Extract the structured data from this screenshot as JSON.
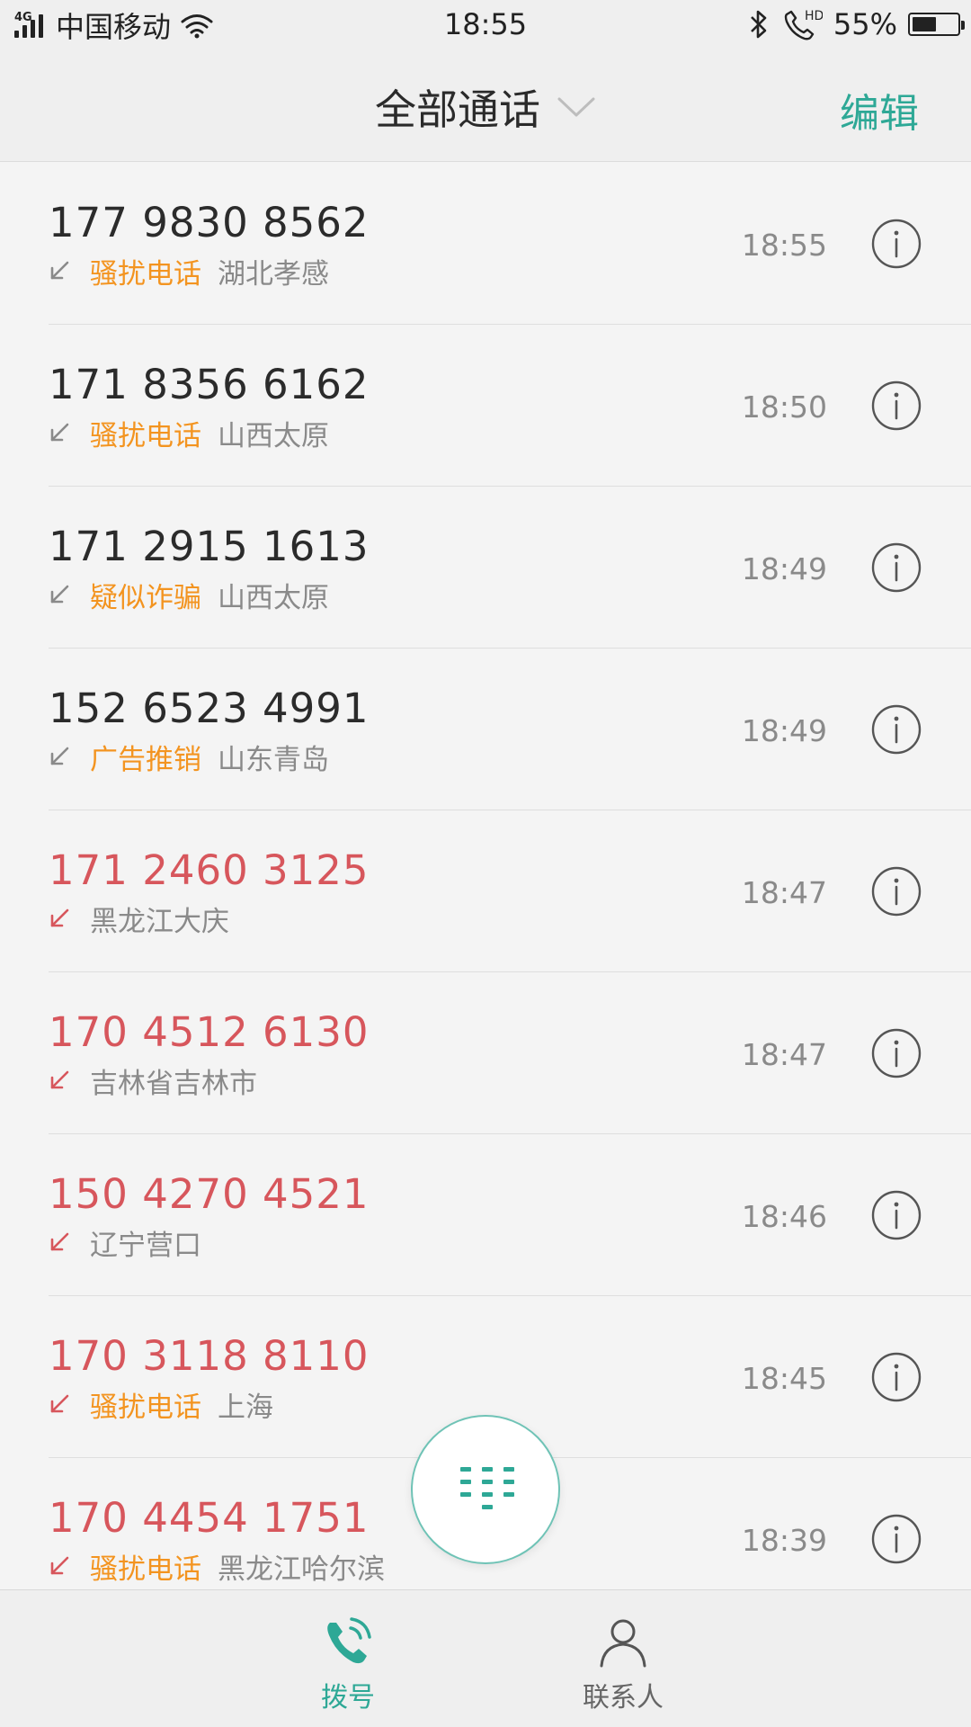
{
  "status_bar": {
    "network": "4G",
    "carrier": "中国移动",
    "time": "18:55",
    "hd_label": "HD",
    "battery_text": "55%",
    "battery_level": 0.55
  },
  "header": {
    "title": "全部通话",
    "edit_label": "编辑"
  },
  "calls": [
    {
      "number": "177 9830 8562",
      "missed": false,
      "tag": "骚扰电话",
      "location": "湖北孝感",
      "time": "18:55"
    },
    {
      "number": "171 8356 6162",
      "missed": false,
      "tag": "骚扰电话",
      "location": "山西太原",
      "time": "18:50"
    },
    {
      "number": "171 2915 1613",
      "missed": false,
      "tag": "疑似诈骗",
      "location": "山西太原",
      "time": "18:49"
    },
    {
      "number": "152 6523 4991",
      "missed": false,
      "tag": "广告推销",
      "location": "山东青岛",
      "time": "18:49"
    },
    {
      "number": "171 2460 3125",
      "missed": true,
      "tag": "",
      "location": "黑龙江大庆",
      "time": "18:47"
    },
    {
      "number": "170 4512 6130",
      "missed": true,
      "tag": "",
      "location": "吉林省吉林市",
      "time": "18:47"
    },
    {
      "number": "150 4270 4521",
      "missed": true,
      "tag": "",
      "location": "辽宁营口",
      "time": "18:46"
    },
    {
      "number": "170 3118 8110",
      "missed": true,
      "tag": "骚扰电话",
      "location": "上海",
      "time": "18:45"
    },
    {
      "number": "170 4454 1751",
      "missed": true,
      "tag": "骚扰电话",
      "location": "黑龙江哈尔滨",
      "time": "18:39"
    }
  ],
  "bottom_nav": {
    "dial_label": "拨号",
    "contacts_label": "联系人"
  },
  "colors": {
    "accent": "#2ea896",
    "missed": "#d7565c",
    "tag": "#f39420",
    "received_arrow": "#8a8a8a"
  },
  "icons": {
    "fab": "dialpad-icon",
    "dial_tab": "phone-icon",
    "contacts_tab": "person-icon",
    "row_info": "info-icon",
    "row_direction": "incoming-arrow-icon"
  }
}
